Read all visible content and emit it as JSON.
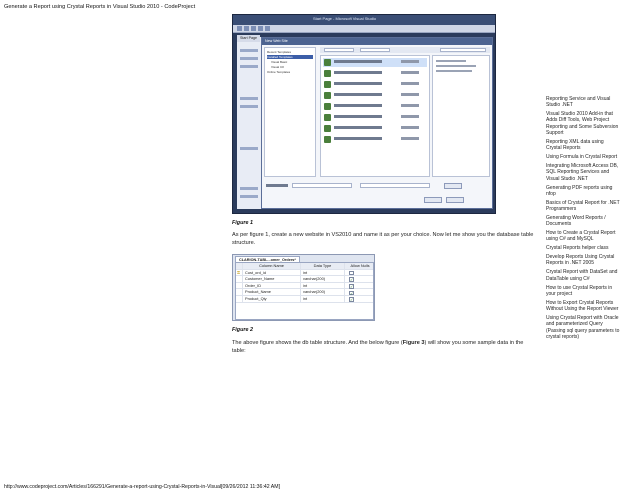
{
  "page": {
    "title": "Generate a Report using Crystal Reports in Visual Studio 2010 - CodeProject",
    "footer": "http://www.codeproject.com/Articles/166291/Generate-a-report-using-Crystal-Reports-in-Visual[09/26/2012 11:36:42 AM]"
  },
  "figure1": {
    "caption": "Figure 1",
    "window_title": "Start Page - Microsoft Visual Studio",
    "tab": "Start Page",
    "dialog_title": "New Web Site",
    "templates": [
      "Recent Templates",
      "Installed Templates",
      "Visual Basic",
      "Visual C#",
      "Online Templates"
    ]
  },
  "para1": "As per figure 1, create a new website in VS2010 and name it as per your choice. Now let me show you the database table structure.",
  "figure2": {
    "caption": "Figure 2",
    "tab_title": "CLARION-TABL...omer_Orders*",
    "columns": [
      "Column Name",
      "Data Type",
      "Allow Nulls"
    ],
    "rows": [
      {
        "name": "Cust_ord_id",
        "type": "int",
        "nulls": false,
        "key": true
      },
      {
        "name": "Customer_Name",
        "type": "varchar(200)",
        "nulls": true,
        "key": false
      },
      {
        "name": "Order_ID",
        "type": "int",
        "nulls": true,
        "key": false
      },
      {
        "name": "Product_Name",
        "type": "varchar(200)",
        "nulls": true,
        "key": false
      },
      {
        "name": "Product_Qty",
        "type": "int",
        "nulls": true,
        "key": false
      }
    ]
  },
  "para2": {
    "before": "The above figure shows the db table structure. And the below figure (",
    "bold": "Figure 3",
    "after": ") will show you some sample data in the table:"
  },
  "sidebar_links": [
    "Reporting Service and Visual Studio .NET",
    "Visual Studio 2010 Add-in that Adds Diff Tools, Web Project Reporting and Some Subversion Support",
    "Reporting XML data using Crystal Reports",
    "Using Formula in Crystal Report",
    "Integrating Microsoft Access DB, SQL Reporting Services and Visual Studio .NET",
    "Generating PDF reports using nfop",
    "Basics of Crystal Report for .NET Programmers",
    "Generating Word Reports / Documents",
    "How to Create a Crystal Report using C# and MySQL",
    "Crystal Reports helper class",
    "Develop Reports Using Crystal Reports in .NET 2005",
    "Crystal Report with DataSet and DataTable using C#",
    "How to use Crystal Reports in your project",
    "How to Export Crystal Reports Without Using the Report Viewer",
    "Using Crystal Report with Oracle and parameterized Query (Passing sql query parameters to crystal reports)"
  ]
}
